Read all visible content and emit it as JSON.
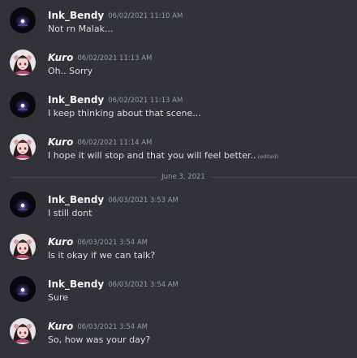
{
  "divider": {
    "label": "June 3, 2021"
  },
  "messages": [
    {
      "author": "Ink_Bendy",
      "avatar": "dark-orb-avatar",
      "timestamp": "06/02/2021 11:10 AM",
      "text": "Not rn Malak..."
    },
    {
      "author": "Kuro",
      "avatar": "anime-girl-avatar",
      "timestamp": "06/02/2021 11:13 AM",
      "text": "Oh.. Sorry"
    },
    {
      "author": "Ink_Bendy",
      "avatar": "dark-orb-avatar",
      "timestamp": "06/02/2021 11:13 AM",
      "text": "I keep thinking about that scene..."
    },
    {
      "author": "Kuro",
      "avatar": "anime-girl-avatar",
      "timestamp": "06/02/2021 11:14 AM",
      "text": "I hope it will stop and that you will feel better..",
      "edited": "(edited)"
    },
    {
      "author": "Ink_Bendy",
      "avatar": "dark-orb-avatar",
      "timestamp": "06/03/2021 3:53 AM",
      "text": "I still dont"
    },
    {
      "author": "Kuro",
      "avatar": "anime-girl-avatar",
      "timestamp": "06/03/2021 3:54 AM",
      "text": "Is it okay if we can talk?"
    },
    {
      "author": "Ink_Bendy",
      "avatar": "dark-orb-avatar",
      "timestamp": "06/03/2021 3:54 AM",
      "text": "Sure"
    },
    {
      "author": "Kuro",
      "avatar": "anime-girl-avatar",
      "timestamp": "06/03/2021 3:54 AM",
      "text": "So, how was your day?"
    }
  ],
  "colors": {
    "background": "#323339",
    "author": "#f2f3f5",
    "message_text": "#dbdee1",
    "muted": "#949ba4",
    "divider_line": "#44464d"
  }
}
